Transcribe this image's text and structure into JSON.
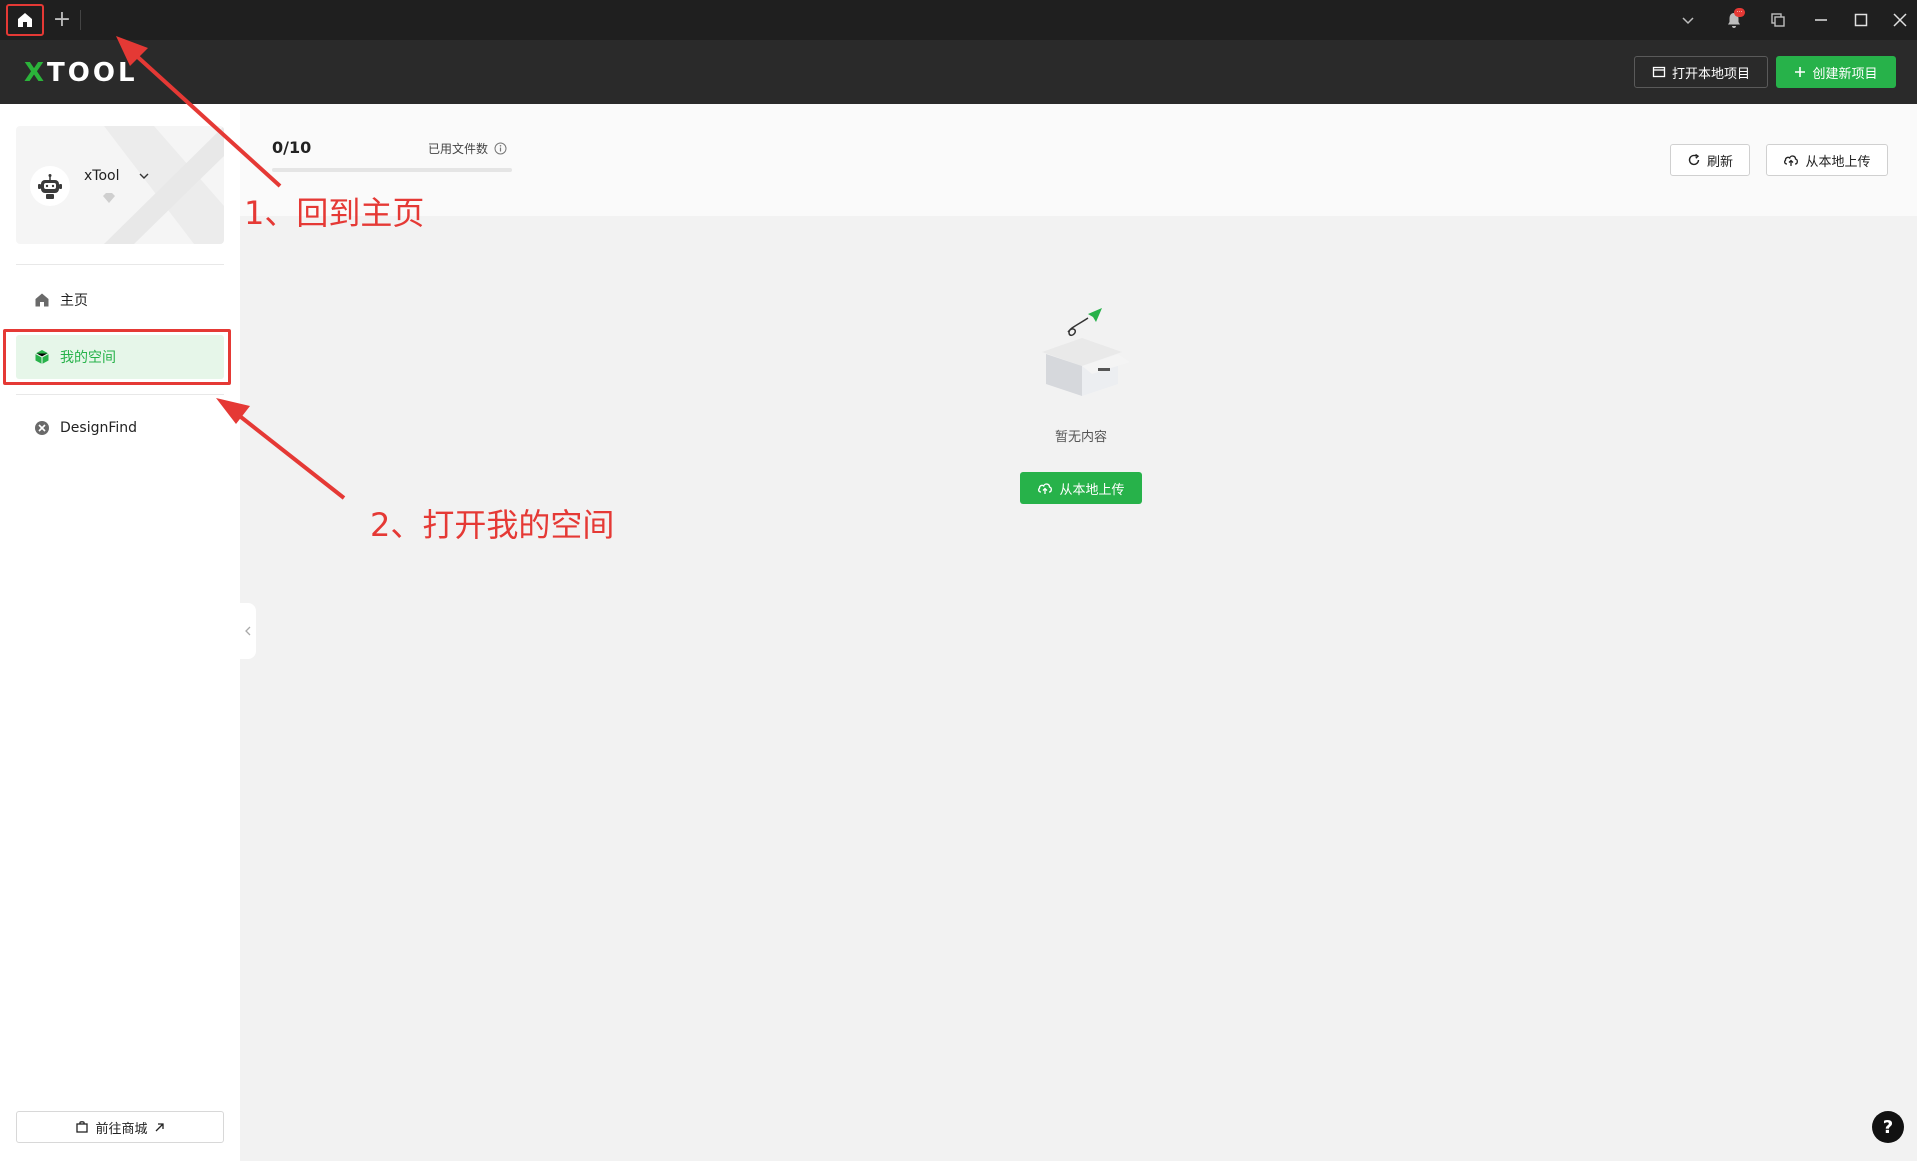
{
  "titlebar": {
    "tab_add_label": "+",
    "icons": [
      "home-icon",
      "plus-icon",
      "chevron-down-icon",
      "bell-icon",
      "windows-icon",
      "minimize-icon",
      "maximize-icon",
      "close-icon"
    ],
    "notification_badge": "···"
  },
  "appbar": {
    "logo": "XTOOL",
    "open_local_label": "打开本地项目",
    "create_new_label": "创建新项目"
  },
  "sidebar": {
    "user_name": "xTool",
    "items": [
      {
        "label": "主页",
        "icon": "home-icon"
      },
      {
        "label": "我的空间",
        "icon": "cube-icon",
        "active": true
      },
      {
        "label": "DesignFind",
        "icon": "designfind-icon"
      }
    ],
    "shop_label": "前往商城"
  },
  "main": {
    "file_count": "0/10",
    "used_files_label": "已用文件数",
    "usage_fraction": 0,
    "refresh_label": "刷新",
    "upload_label": "从本地上传",
    "empty_text": "暂无内容",
    "empty_upload_label": "从本地上传",
    "help_label": "?"
  },
  "annotations": {
    "step1": "1、回到主页",
    "step2": "2、打开我的空间"
  },
  "colors": {
    "accent": "#27b24a",
    "annotation": "#e53935",
    "titlebar": "#1f1f1f",
    "appbar": "#2a2a2a"
  }
}
